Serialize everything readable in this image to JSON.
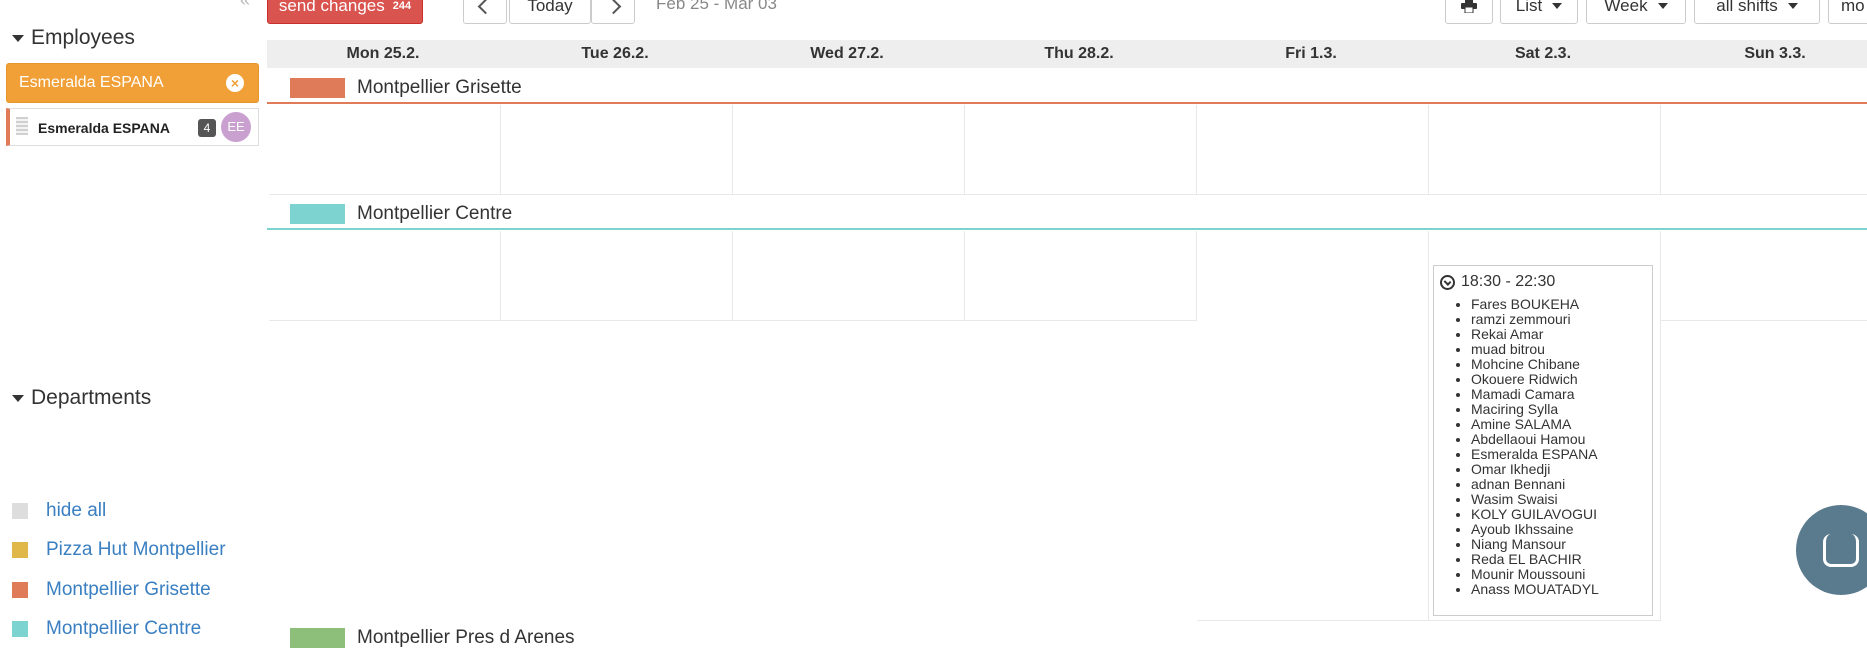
{
  "sidebar": {
    "employees_header": "Employees",
    "search": {
      "value": "Esmeralda ESPANA",
      "clear_glyph": "×"
    },
    "employee": {
      "name": "Esmeralda ESPANA",
      "count": "4",
      "initials": "EE",
      "color": "#e07b5a"
    },
    "departments_header": "Departments",
    "departments": [
      {
        "label": "hide all",
        "color": "#dddddd"
      },
      {
        "label": "Pizza Hut Montpellier",
        "color": "#e0b84a"
      },
      {
        "label": "Montpellier Grisette",
        "color": "#e07b5a"
      },
      {
        "label": "Montpellier Centre",
        "color": "#7dd3cf"
      }
    ]
  },
  "toolbar": {
    "send_label": "send changes",
    "send_count": "244",
    "today_label": "Today",
    "date_range": "Feb 25 - Mar 03",
    "print_icon": "print-icon",
    "list_label": "List",
    "week_label": "Week",
    "shifts_label": "all shifts",
    "more_label": "mo"
  },
  "calendar": {
    "days": [
      "Mon 25.2.",
      "Tue 26.2.",
      "Wed 27.2.",
      "Thu 28.2.",
      "Fri 1.3.",
      "Sat 2.3.",
      "Sun 3.3."
    ],
    "departments": [
      {
        "name": "Montpellier Grisette",
        "color": "#e07b5a"
      },
      {
        "name": "Montpellier Centre",
        "color": "#7dd3cf"
      },
      {
        "name": "Montpellier Pres d Arenes",
        "color": "#8dbf7a"
      }
    ],
    "shift": {
      "time": "18:30 - 22:30",
      "employees": [
        "Fares BOUKEHA",
        "ramzi zemmouri",
        "Rekai Amar",
        "muad bitrou",
        "Mohcine Chibane",
        "Okouere Ridwich",
        "Mamadi Camara",
        "Maciring Sylla",
        "Amine SALAMA",
        "Abdellaoui Hamou",
        "Esmeralda ESPANA",
        "Omar Ikhedji",
        "adnan Bennani",
        "Wasim Swaisi",
        "KOLY GUILAVOGUI",
        "Ayoub Ikhssaine",
        "Niang Mansour",
        "Reda EL BACHIR",
        "Mounir Moussouni",
        "Anass MOUATADYL"
      ]
    }
  }
}
